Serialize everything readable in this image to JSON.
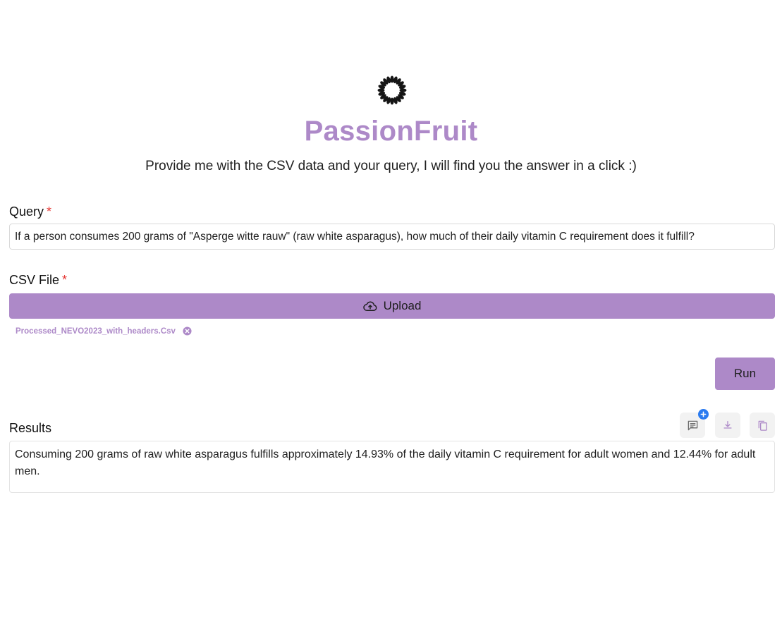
{
  "app": {
    "title": "PassionFruit",
    "subtitle": "Provide me with the CSV data and your query, I will find you the answer in a click :)",
    "accent_color": "#ad89c8",
    "logo_icon": "sunburst-logo-icon"
  },
  "query": {
    "label": "Query",
    "required_mark": "*",
    "value": "If a person consumes 200 grams of \"Asperge witte rauw\" (raw white asparagus), how much of their daily vitamin C requirement does it fulfill?"
  },
  "csv": {
    "label": "CSV File",
    "required_mark": "*",
    "upload_label": "Upload",
    "upload_icon": "cloud-upload-icon",
    "file_name": "Processed_NEVO2023_with_headers.Csv",
    "remove_icon": "close-circle-icon"
  },
  "actions": {
    "run_label": "Run"
  },
  "results": {
    "label": "Results",
    "text": "Consuming 200 grams of raw white asparagus fulfills approximately 14.93% of the daily vitamin C requirement for adult women and 12.44% for adult men.",
    "tools": [
      "comment-icon",
      "download-icon",
      "copy-icon"
    ]
  }
}
